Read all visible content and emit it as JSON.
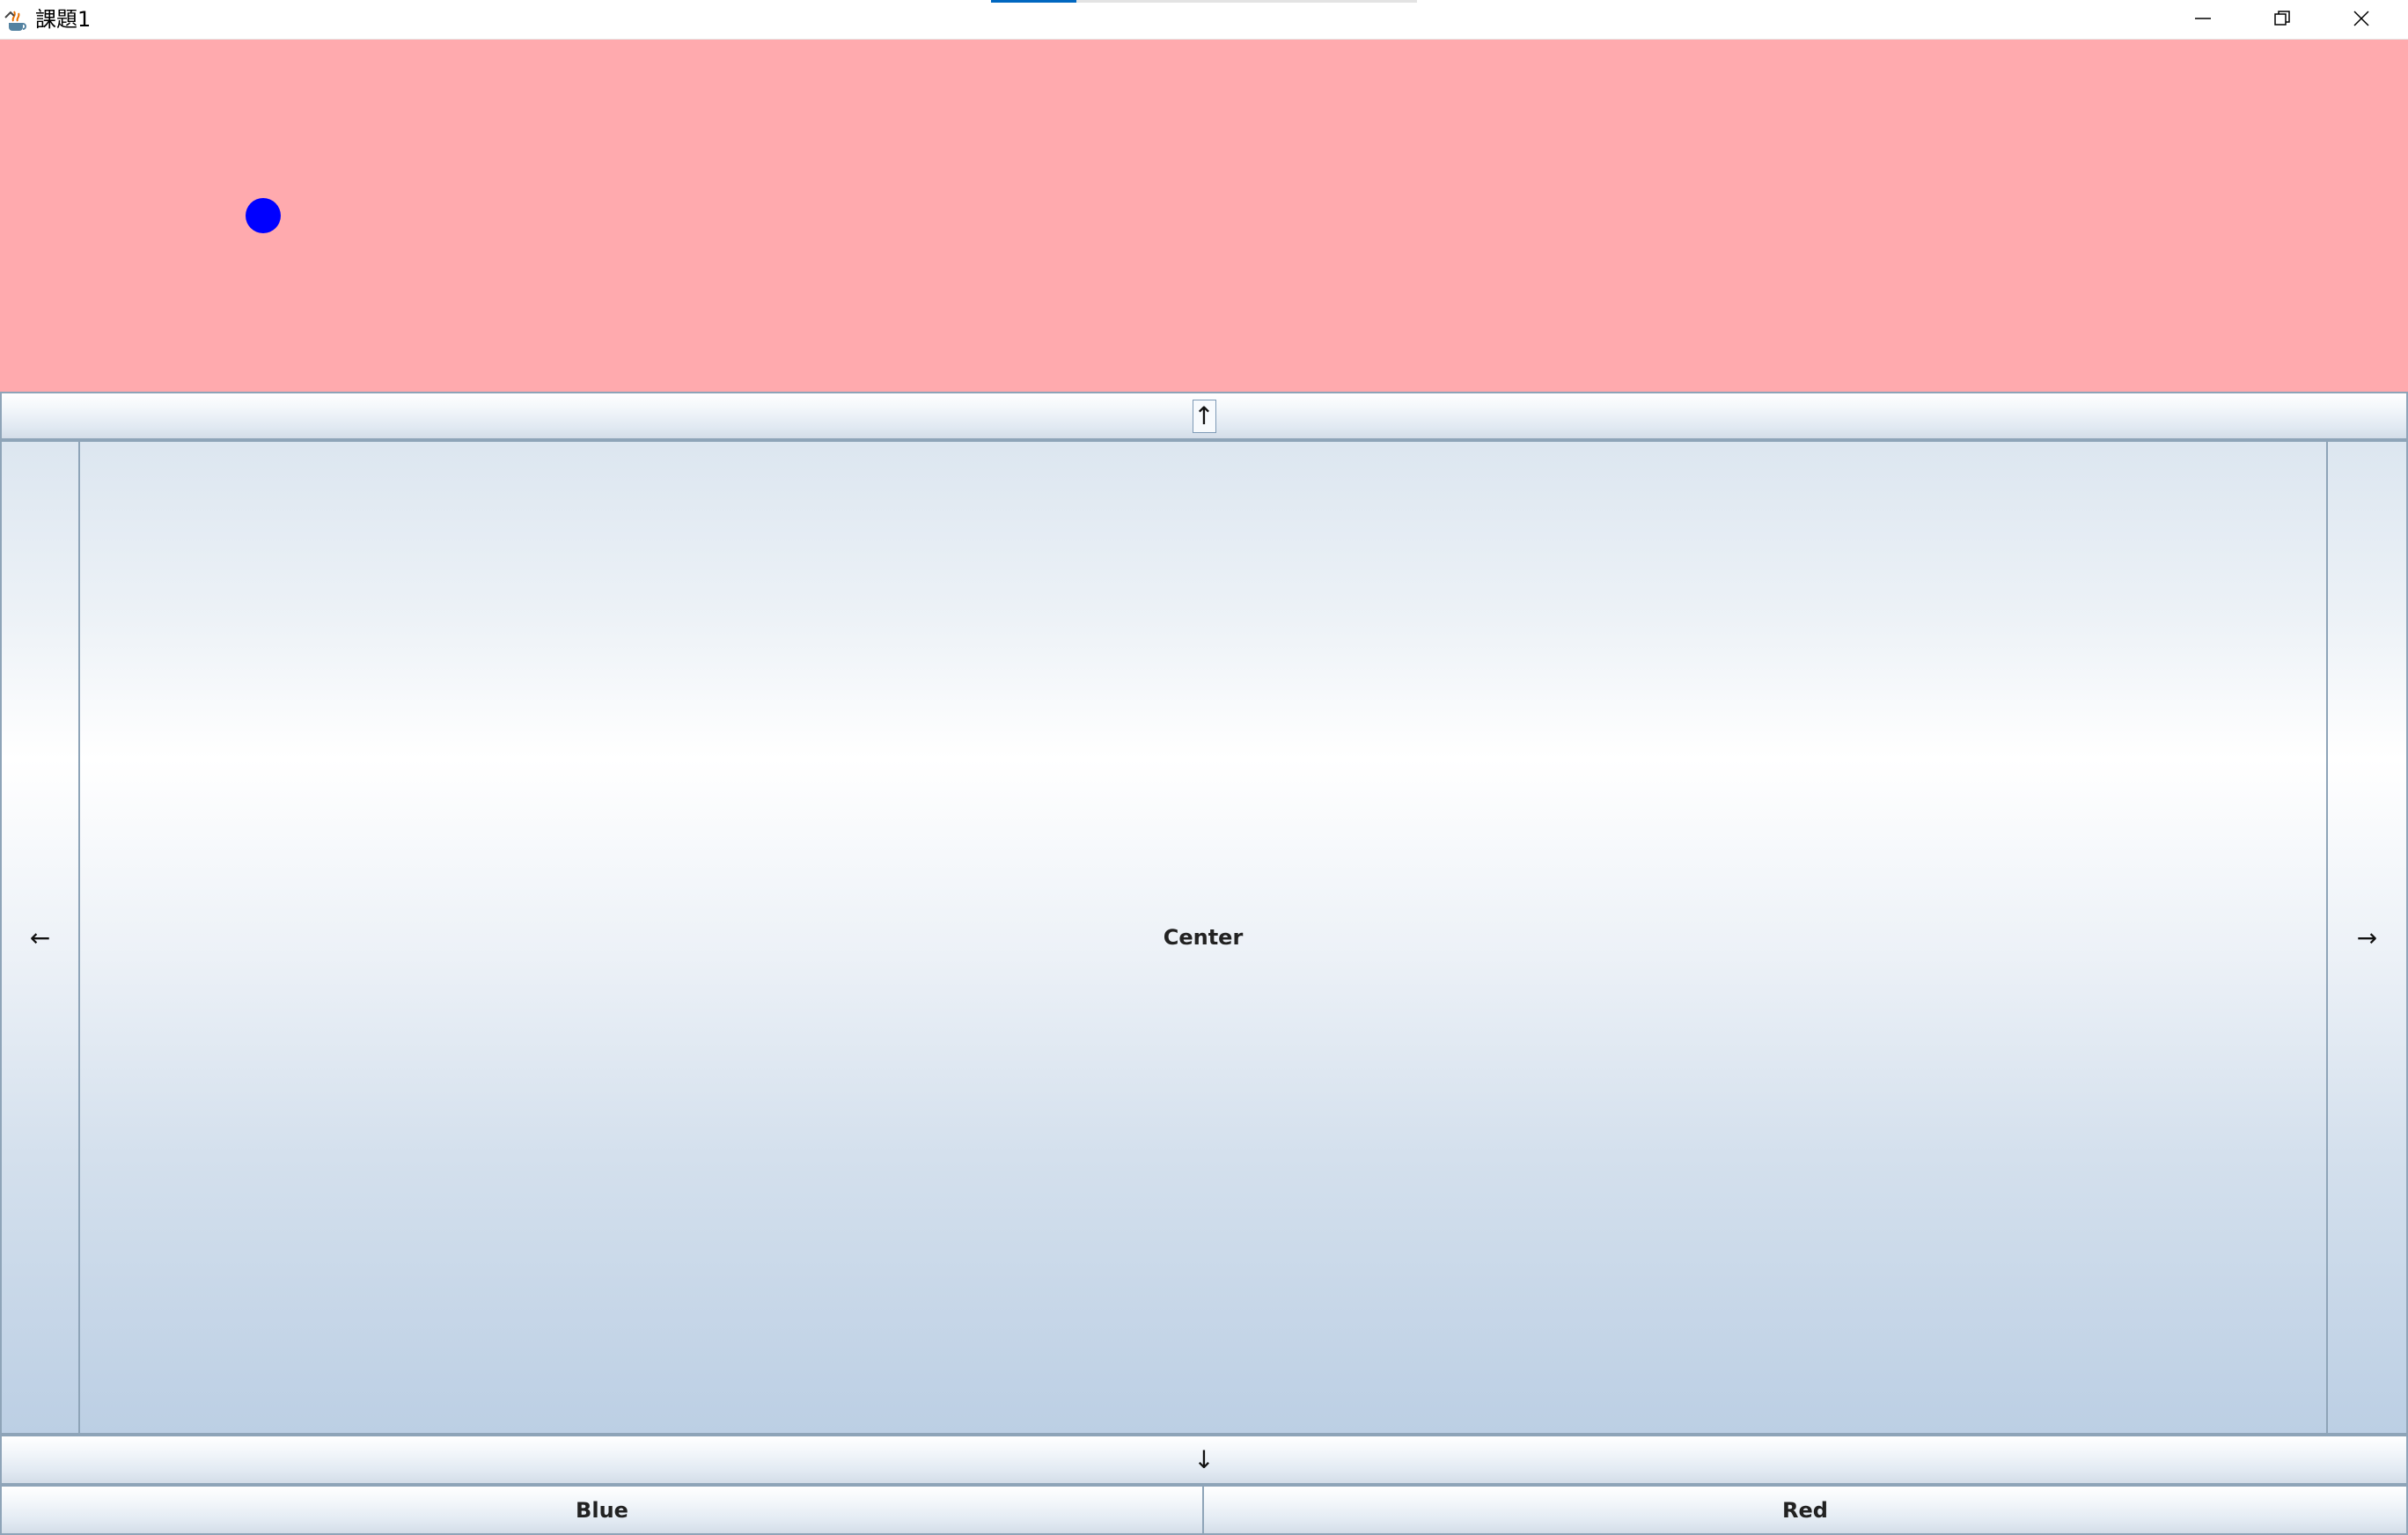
{
  "window": {
    "title": "課題1",
    "title_progress_fraction": 0.2
  },
  "icons": {
    "app": "java-cup-icon",
    "minimize": "minimize-icon",
    "maximize": "restore-icon",
    "close": "close-icon"
  },
  "canvas": {
    "background_color": "#ffaaae",
    "ball_color": "#0000ff"
  },
  "buttons": {
    "up": "↑",
    "left": "←",
    "center": "Center",
    "right": "→",
    "down": "↓",
    "blue": "Blue",
    "red": "Red"
  },
  "colors": {
    "button_border": "#8ea4b8",
    "progress_accent": "#0067c0"
  }
}
